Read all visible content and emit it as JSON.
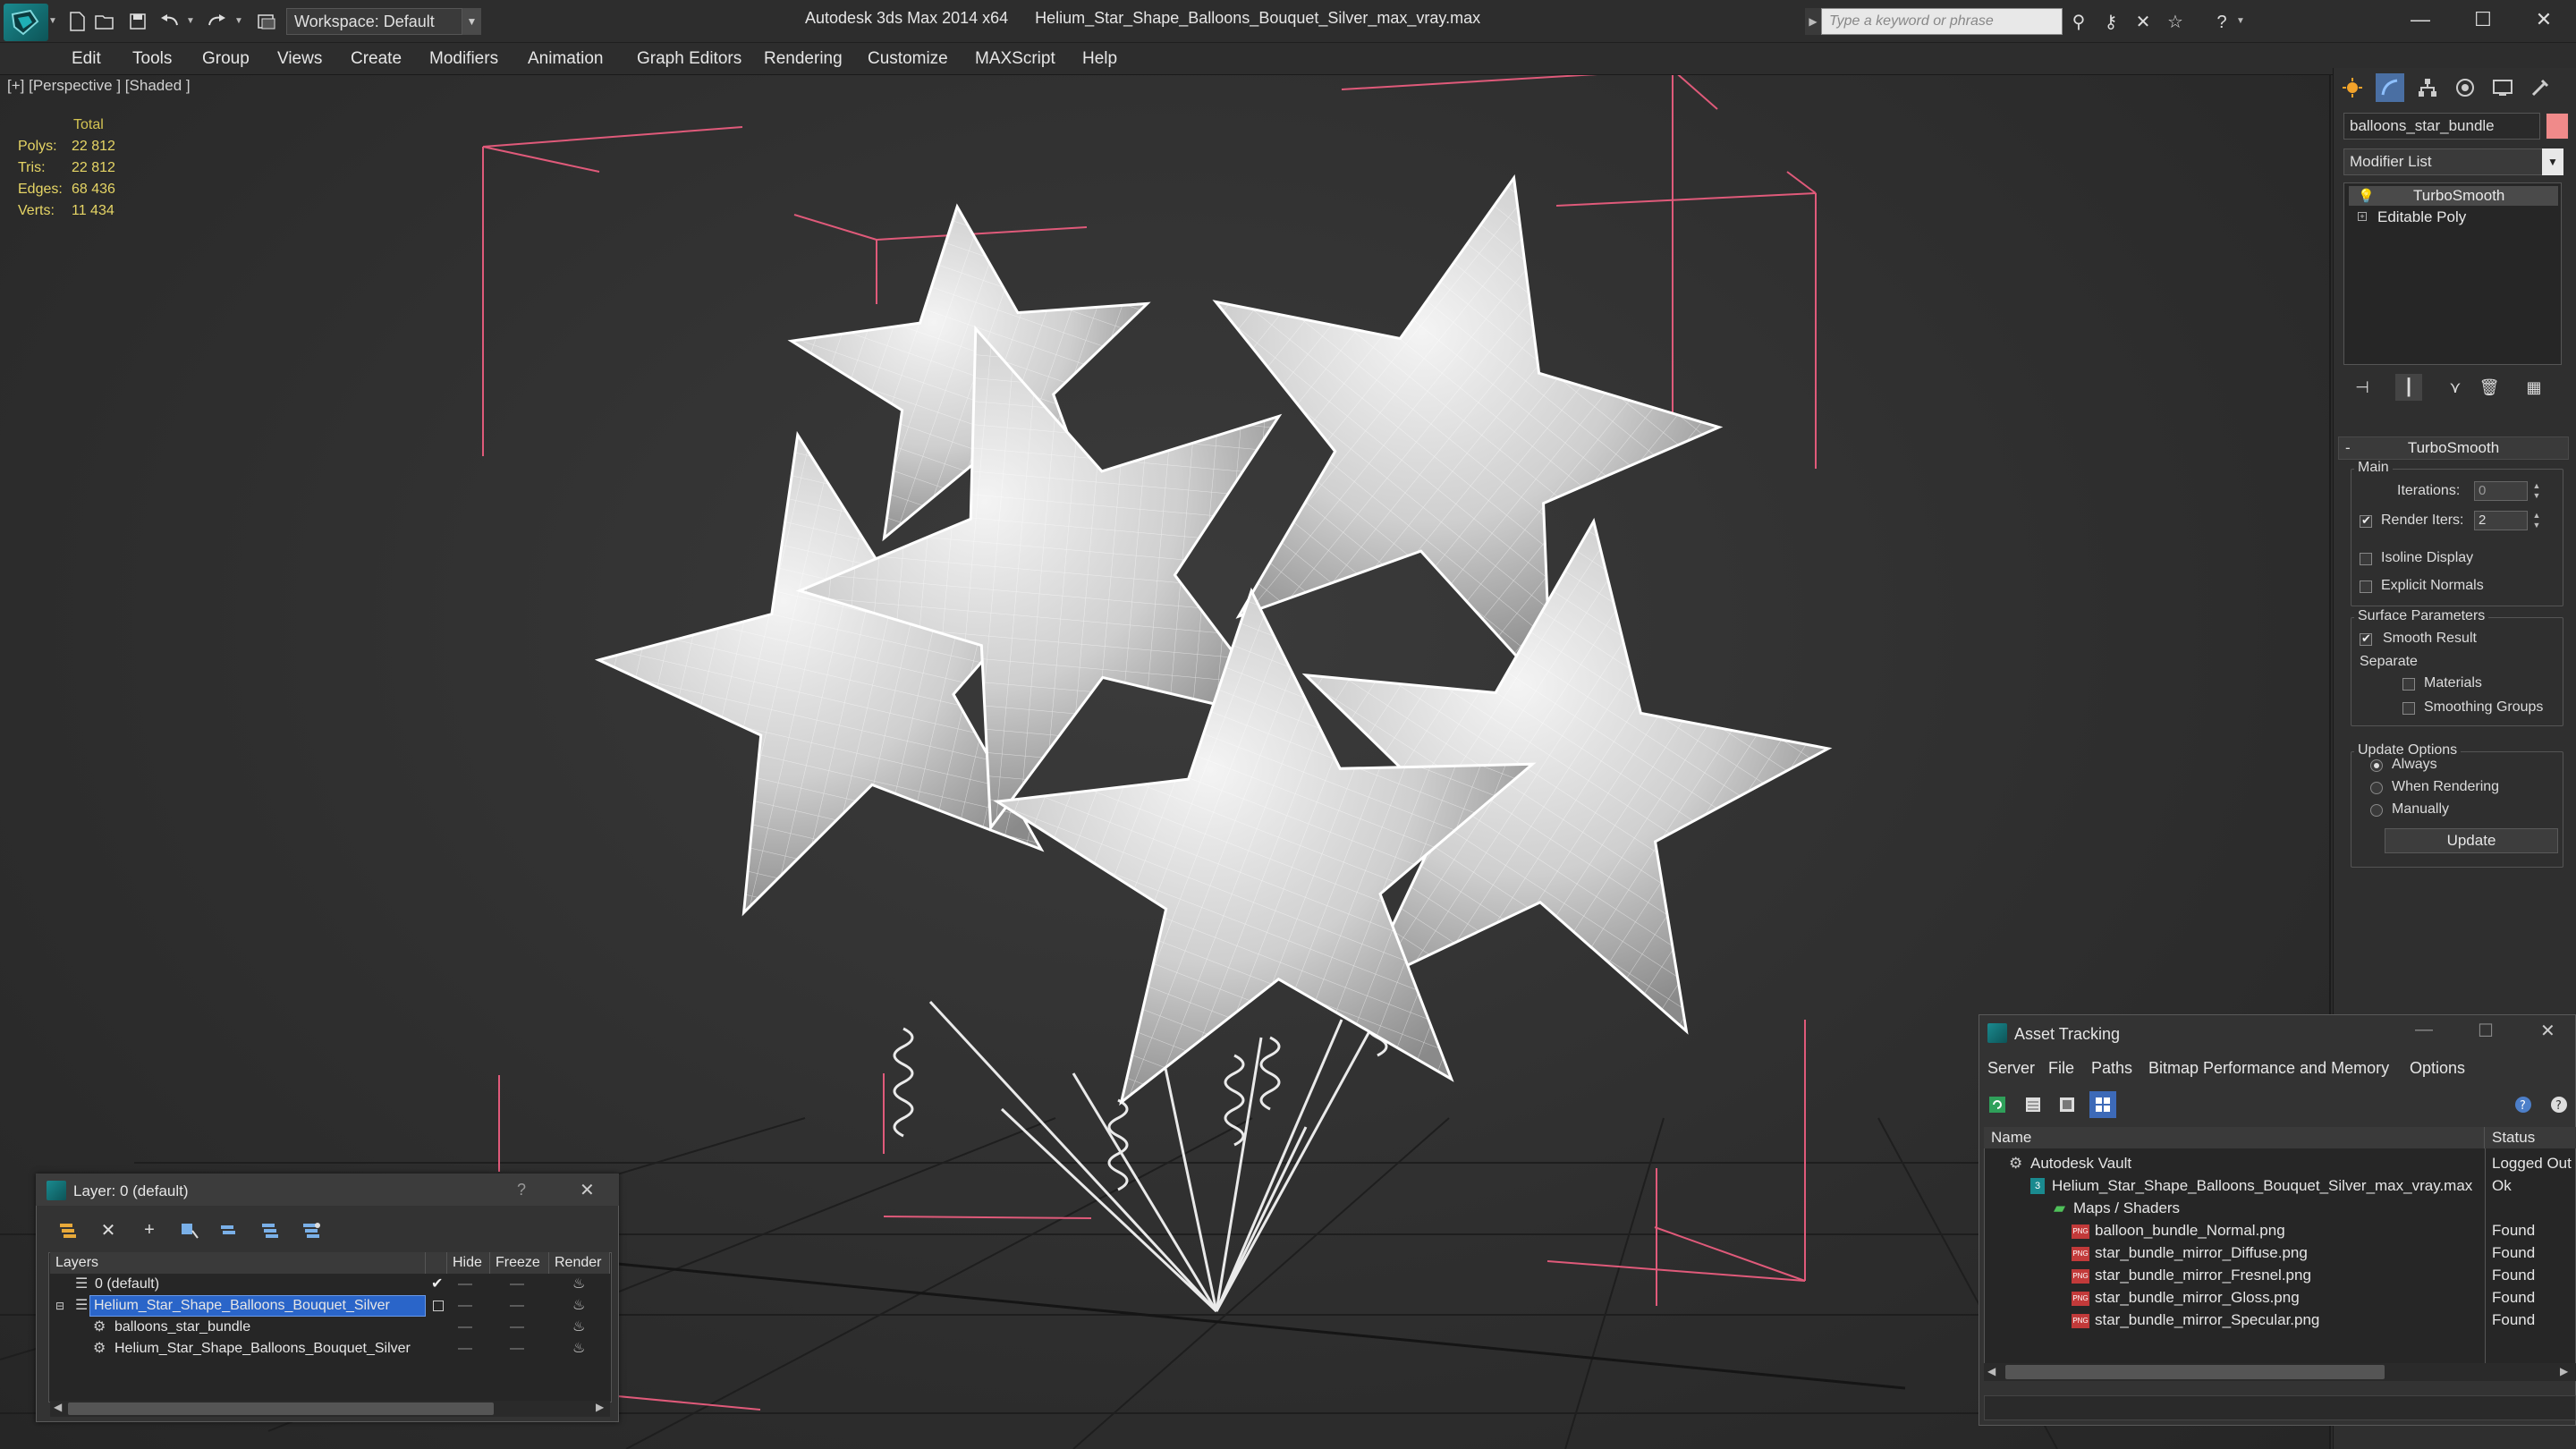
{
  "app": {
    "window_title": "Autodesk 3ds Max 2014 x64      Helium_Star_Shape_Balloons_Bouquet_Silver_max_vray.max",
    "workspace": "Workspace: Default",
    "search_placeholder": "Type a keyword or phrase"
  },
  "menu": [
    "Edit",
    "Tools",
    "Group",
    "Views",
    "Create",
    "Modifiers",
    "Animation",
    "Graph Editors",
    "Rendering",
    "Customize",
    "MAXScript",
    "Help"
  ],
  "viewport": {
    "label": "[+] [Perspective ] [Shaded ]",
    "stats": {
      "header": "Total",
      "rows": [
        {
          "label": "Polys:",
          "value": "22 812"
        },
        {
          "label": "Tris:",
          "value": "22 812"
        },
        {
          "label": "Edges:",
          "value": "68 436"
        },
        {
          "label": "Verts:",
          "value": "11 434"
        }
      ]
    }
  },
  "command_panel": {
    "object_name": "balloons_star_bundle",
    "object_color": "#f08a8a",
    "modifier_list": "Modifier List",
    "stack": [
      "TurboSmooth",
      "Editable Poly"
    ],
    "rollout_title": "TurboSmooth",
    "main_group": "Main",
    "iterations_label": "Iterations:",
    "iterations_value": "0",
    "render_iters_label": "Render Iters:",
    "render_iters_value": "2",
    "render_iters_checked": true,
    "isoline_label": "Isoline Display",
    "explicit_normals_label": "Explicit Normals",
    "surface_group": "Surface Parameters",
    "smooth_result_label": "Smooth Result",
    "separate_label": "Separate",
    "materials_label": "Materials",
    "smoothing_groups_label": "Smoothing Groups",
    "update_group": "Update Options",
    "always_label": "Always",
    "when_rendering_label": "When Rendering",
    "manually_label": "Manually",
    "update_button": "Update"
  },
  "layer_dialog": {
    "title": "Layer: 0 (default)",
    "help": "?",
    "close": "✕",
    "columns": [
      "Layers",
      "Hide",
      "Freeze",
      "Render"
    ],
    "rows": [
      {
        "name": "0 (default)",
        "selected": false,
        "indent": 1,
        "current": true
      },
      {
        "name": "Helium_Star_Shape_Balloons_Bouquet_Silver",
        "selected": true,
        "indent": 1,
        "current": false
      },
      {
        "name": "balloons_star_bundle",
        "selected": false,
        "indent": 2,
        "current": false
      },
      {
        "name": "Helium_Star_Shape_Balloons_Bouquet_Silver",
        "selected": false,
        "indent": 2,
        "current": false
      }
    ]
  },
  "asset_tracking": {
    "title": "Asset Tracking",
    "menu": [
      "Server",
      "File",
      "Paths",
      "Bitmap Performance and Memory",
      "Options"
    ],
    "columns": [
      "Name",
      "Status"
    ],
    "rows": [
      {
        "name": "Autodesk Vault",
        "status": "Logged Out",
        "indent": 0,
        "icon": "vault"
      },
      {
        "name": "Helium_Star_Shape_Balloons_Bouquet_Silver_max_vray.max",
        "status": "Ok",
        "indent": 1,
        "icon": "max"
      },
      {
        "name": "Maps / Shaders",
        "status": "",
        "indent": 2,
        "icon": "maps"
      },
      {
        "name": "balloon_bundle_Normal.png",
        "status": "Found",
        "indent": 3,
        "icon": "png"
      },
      {
        "name": "star_bundle_mirror_Diffuse.png",
        "status": "Found",
        "indent": 3,
        "icon": "png"
      },
      {
        "name": "star_bundle_mirror_Fresnel.png",
        "status": "Found",
        "indent": 3,
        "icon": "png"
      },
      {
        "name": "star_bundle_mirror_Gloss.png",
        "status": "Found",
        "indent": 3,
        "icon": "png"
      },
      {
        "name": "star_bundle_mirror_Specular.png",
        "status": "Found",
        "indent": 3,
        "icon": "png"
      }
    ]
  }
}
